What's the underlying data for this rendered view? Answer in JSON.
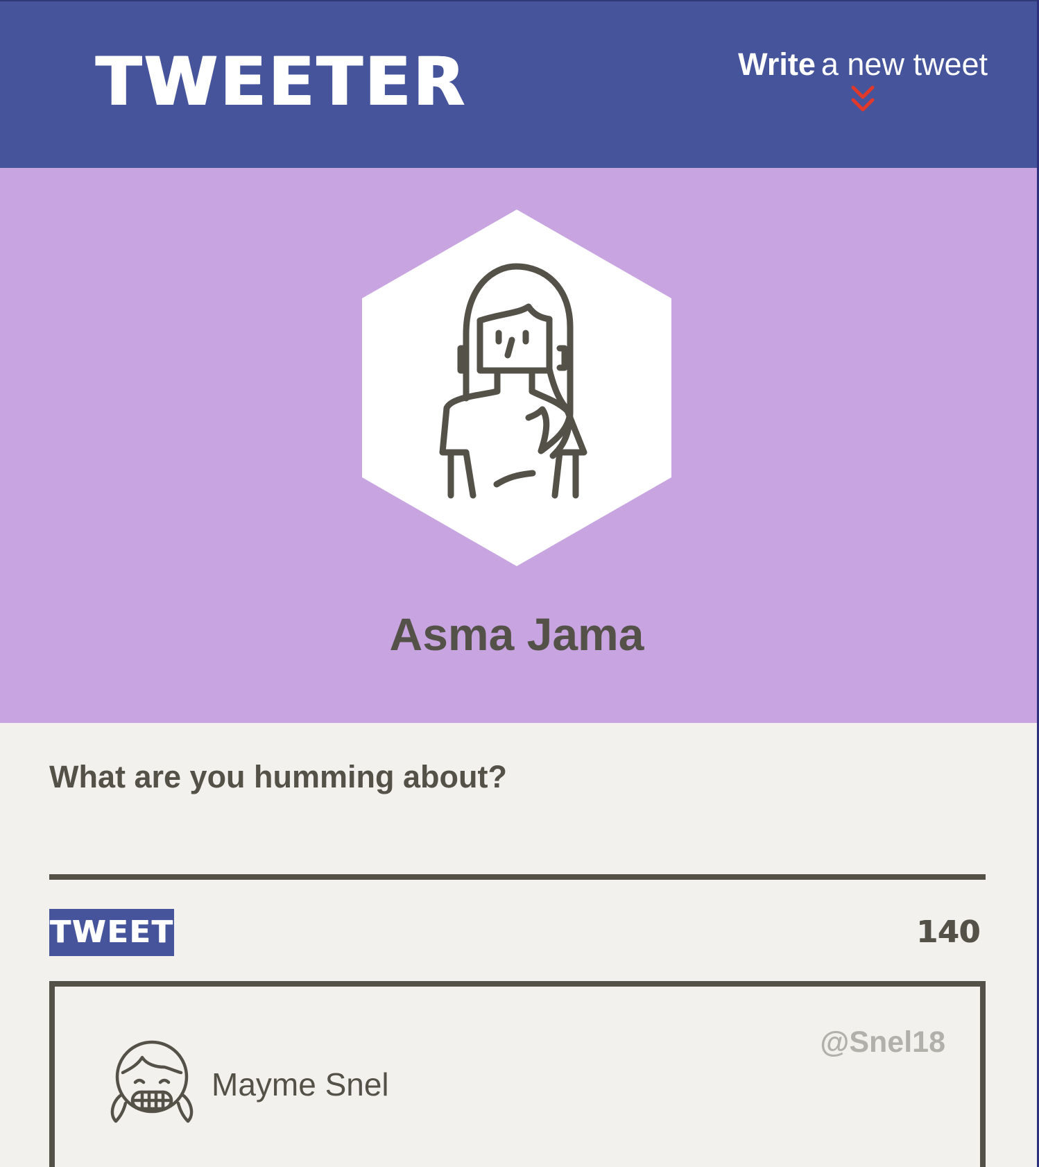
{
  "header": {
    "logo": "TWEETER",
    "write_strong": "Write",
    "write_rest": "a new tweet",
    "chevron_icon": "double-chevron-down-icon"
  },
  "profile": {
    "name": "Asma Jama",
    "avatar_icon": "woman-avatar-icon"
  },
  "compose": {
    "label": "What are you humming about?",
    "input_value": "",
    "input_placeholder": "",
    "tweet_button": "TWEET",
    "counter": "140"
  },
  "tweets": [
    {
      "author": "Mayme Snel",
      "handle": "@Snel18",
      "avatar_icon": "girl-grinning-avatar-icon"
    }
  ],
  "colors": {
    "header_bg": "#46549b",
    "profile_bg": "#c8a4e1",
    "page_bg": "#f3f1ed",
    "text_dark": "#545149",
    "handle_gray": "#b2b0ab",
    "chevron_red": "#e0392b"
  }
}
